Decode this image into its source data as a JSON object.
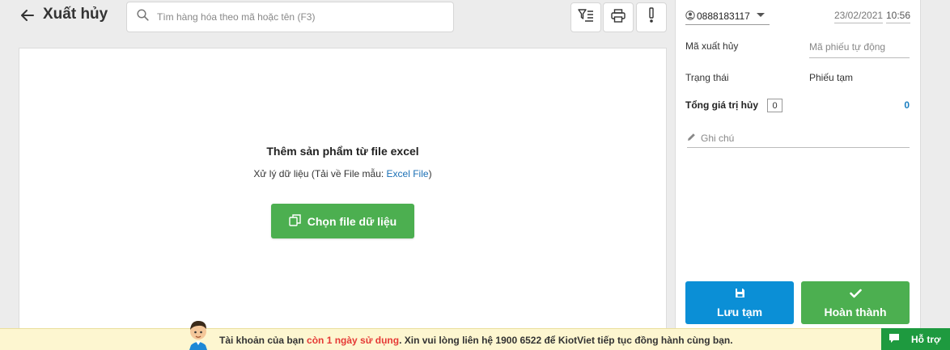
{
  "header": {
    "title": "Xuất hủy",
    "search_placeholder": "Tìm hàng hóa theo mã hoặc tên (F3)"
  },
  "import": {
    "title": "Thêm sản phẩm từ file excel",
    "subtitle_prefix": "Xử lý dữ liệu (Tải về File mẫu: ",
    "subtitle_link": "Excel File",
    "subtitle_suffix": ")",
    "choose_button": "Chọn file dữ liệu"
  },
  "side": {
    "user": "0888183117",
    "date": "23/02/2021",
    "time": "10:56",
    "code_label": "Mã xuất hủy",
    "code_placeholder": "Mã phiếu tự động",
    "status_label": "Trạng thái",
    "status_value": "Phiếu tạm",
    "total_label": "Tổng giá trị hủy",
    "total_qty": "0",
    "total_value": "0",
    "note_placeholder": "Ghi chú",
    "save_button": "Lưu tạm",
    "complete_button": "Hoàn thành"
  },
  "notice": {
    "prefix": "Tài khoản của bạn ",
    "highlight": "còn 1 ngày sử dụng",
    "suffix": ". Xin vui lòng liên hệ 1900 6522 để KiotViet tiếp tục đồng hành cùng bạn."
  },
  "support": {
    "label": "Hỗ trợ"
  },
  "colors": {
    "green": "#4caf50",
    "blue": "#0b8fd6",
    "link": "#1a6fb5",
    "notice_bg": "#fdf6d0",
    "notice_red": "#e53935"
  }
}
